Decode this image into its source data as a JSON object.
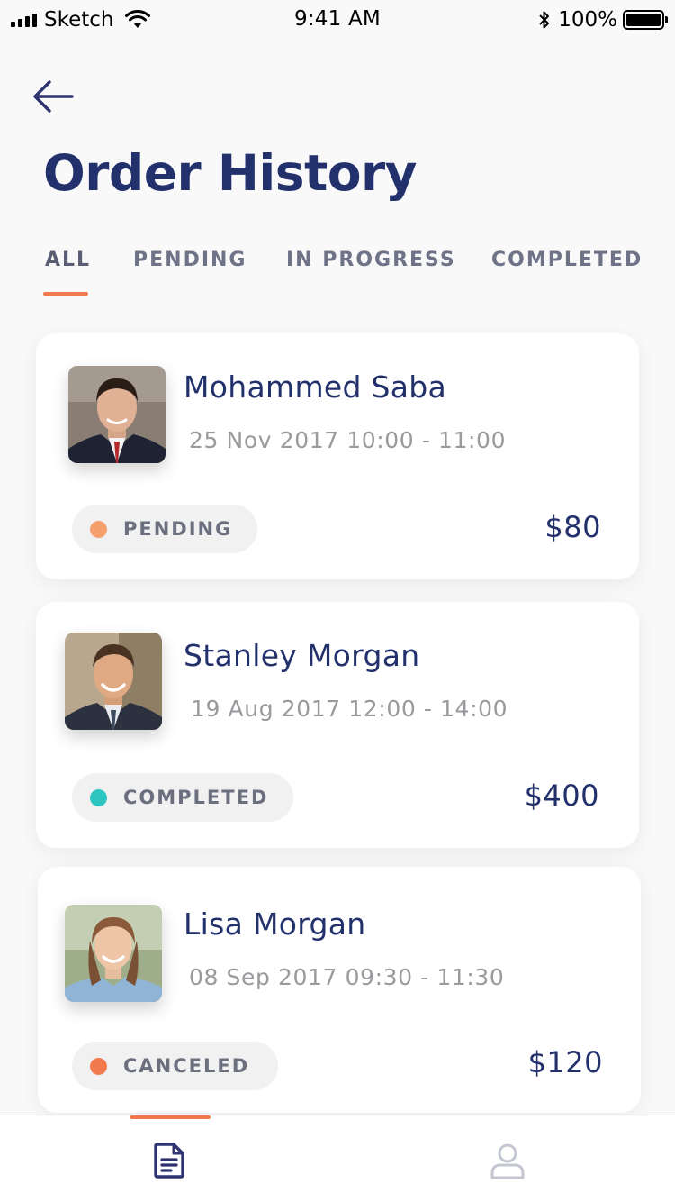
{
  "status_bar": {
    "carrier": "Sketch",
    "time": "9:41 AM",
    "battery": "100%"
  },
  "header": {
    "title": "Order History",
    "back_icon": "arrow-left-icon"
  },
  "tabs": [
    {
      "label": "ALL",
      "active": true
    },
    {
      "label": "PENDING",
      "active": false
    },
    {
      "label": "IN PROGRESS",
      "active": false
    },
    {
      "label": "COMPLETED",
      "active": false
    }
  ],
  "orders": [
    {
      "name": "Mohammed Saba",
      "datetime": "25 Nov 2017 10:00 - 11:00",
      "status": "PENDING",
      "status_color": "#f5a06c",
      "price": "$80"
    },
    {
      "name": "Stanley Morgan",
      "datetime": "19 Aug 2017 12:00 - 14:00",
      "status": "COMPLETED",
      "status_color": "#2cc5bf",
      "price": "$400"
    },
    {
      "name": "Lisa Morgan",
      "datetime": "08 Sep 2017 09:30 - 11:30",
      "status": "CANCELED",
      "status_color": "#f27a4f",
      "price": "$120"
    }
  ],
  "bottom_nav": {
    "items": [
      {
        "icon": "document-icon",
        "active": true
      },
      {
        "icon": "profile-icon",
        "active": false
      }
    ]
  },
  "colors": {
    "accent": "#f2794b",
    "title": "#22306b",
    "background": "#f9f9f9"
  }
}
